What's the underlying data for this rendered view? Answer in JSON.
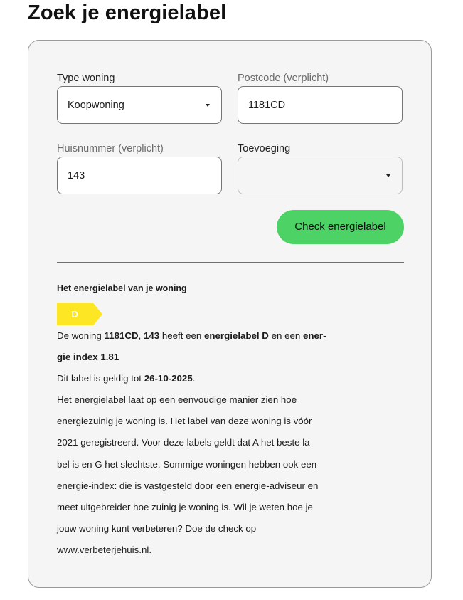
{
  "page": {
    "title": "Zoek je energielabel"
  },
  "form": {
    "type_woning": {
      "label": "Type woning",
      "value": "Koopwoning"
    },
    "postcode": {
      "label": "Postcode (verplicht)",
      "value": "1181CD"
    },
    "huisnummer": {
      "label": "Huisnummer (verplicht)",
      "value": "143"
    },
    "toevoeging": {
      "label": "Toevoeging",
      "value": ""
    },
    "submit_label": "Check energielabel"
  },
  "result": {
    "heading": "Het energielabel van je woning",
    "label_letter": "D",
    "label_color": "#fde724",
    "summary": {
      "prefix": "De woning ",
      "address_postcode": "1181CD",
      "comma": ", ",
      "address_number": "143",
      "middle": " heeft een ",
      "label_phrase": "energielabel D",
      "and": " en een ",
      "index_phrase_line1": "ener-",
      "index_phrase_line2": "gie index 1.81"
    },
    "validity": {
      "prefix": "Dit label is geldig tot ",
      "date": "26-10-2025",
      "suffix": "."
    },
    "explanation_lines": [
      "Het energielabel laat op een eenvoudige manier zien hoe",
      "energiezuinig je woning is. Het label van deze woning is vóór",
      "2021 geregistreerd. Voor deze labels geldt dat A het beste la-",
      "bel is en G het slechtste. Sommige woningen hebben ook een",
      "energie-index: die is vastgesteld door een energie-adviseur en",
      "meet uitgebreider hoe zuinig je woning is. Wil je weten hoe je",
      "jouw woning kunt verbeteren? Doe de check op"
    ],
    "link_text": "www.verbeterjehuis.nl",
    "link_suffix": "."
  },
  "colors": {
    "button": "#4dd266",
    "card_background": "#f5f5f5",
    "label_d": "#fde724"
  }
}
